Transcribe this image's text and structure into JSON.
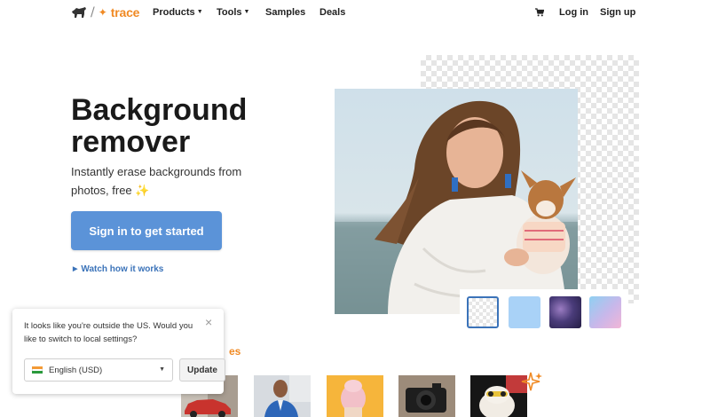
{
  "nav": {
    "logo_text": "trace",
    "items": [
      {
        "label": "Products",
        "has_caret": true
      },
      {
        "label": "Tools",
        "has_caret": true
      },
      {
        "label": "Samples",
        "has_caret": false
      },
      {
        "label": "Deals",
        "has_caret": false
      }
    ],
    "cart_icon": "cart-icon",
    "login": "Log in",
    "signup": "Sign up",
    "caret_glyph": "▼"
  },
  "hero": {
    "title": "Background remover",
    "subtitle": "Instantly erase backgrounds from photos, free ✨",
    "cta": "Sign in to get started",
    "watch_link": "Watch how it works",
    "watch_icon": "▶"
  },
  "preview": {
    "backgrounds": [
      "transparent",
      "light-blue",
      "galaxy",
      "pastel-gradient"
    ],
    "selected_background": "transparent",
    "colors": {
      "light_blue": "#a9d2f7",
      "selected_border": "#3b73b9"
    }
  },
  "samples": {
    "label_partial": "es",
    "thumbnails": [
      "car",
      "man-in-suit",
      "pink-hat",
      "camera",
      "dog-with-sunglasses"
    ]
  },
  "popup": {
    "message": "It looks like you're outside the US. Would you like to switch to local settings?",
    "close_glyph": "×",
    "language": "English (USD)",
    "update": "Update",
    "flag": "india-flag"
  },
  "colors": {
    "accent_orange": "#f08a24",
    "cta_blue": "#5b93d8",
    "link_blue": "#3b73b9"
  }
}
